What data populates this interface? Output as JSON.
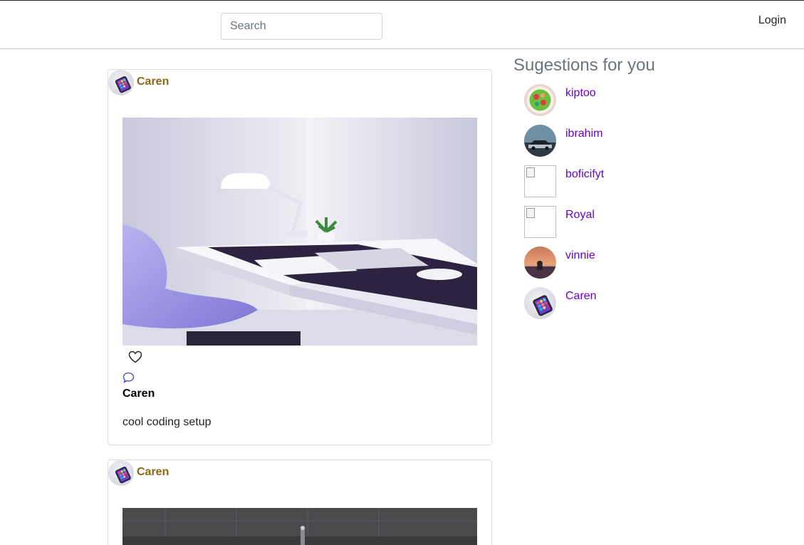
{
  "nav": {
    "search_placeholder": "Search",
    "login_label": "Login"
  },
  "posts": [
    {
      "author": "Caren",
      "caption_user": "Caren",
      "caption": "cool coding setup"
    },
    {
      "author": "Caren"
    }
  ],
  "suggestions": {
    "title": "Sugestions for you",
    "items": [
      {
        "name": "kiptoo",
        "avatar": "salad-photo"
      },
      {
        "name": "ibrahim",
        "avatar": "car-photo"
      },
      {
        "name": "boficifyt",
        "avatar": "broken-image"
      },
      {
        "name": "Royal",
        "avatar": "broken-image"
      },
      {
        "name": "vinnie",
        "avatar": "sunset-photo"
      },
      {
        "name": "Caren",
        "avatar": "phone-photo"
      }
    ]
  },
  "icons": {
    "like": "heart-icon",
    "comment": "comment-icon"
  },
  "colors": {
    "author": "#8b6914",
    "suggestion_link": "#6a00d9",
    "title_gray": "#6c757d",
    "comment_icon": "#3b46d6"
  }
}
